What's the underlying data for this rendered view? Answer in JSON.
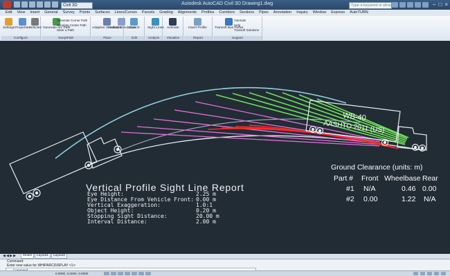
{
  "titlebar": {
    "file_tab": "Civil 3D",
    "title": "Autodesk AutoCAD Civil 3D   Drawing1.dwg",
    "search_placeholder": "Type a keyword or phrase"
  },
  "menubar": {
    "items": [
      "Edit",
      "View",
      "Insert",
      "General",
      "Survey",
      "Points",
      "Surfaces",
      "Lines/Curves",
      "Parcels",
      "Grading",
      "Alignments",
      "Profiles",
      "Corridors",
      "Sections",
      "Pipes",
      "Annotation",
      "Inquiry",
      "Window",
      "Express",
      "AutoTURN"
    ]
  },
  "ribbon": {
    "configure": {
      "label": "Configure",
      "tools": [
        "Settings",
        "Properties",
        "Vehicles"
      ]
    },
    "swept": {
      "label": "SweptPath",
      "tools": [
        "Generate Arc Path"
      ],
      "list": [
        "Generate Corner Path",
        "Simulate Center Path",
        "Steer a Path"
      ]
    },
    "place": {
      "label": "Place",
      "tools": [
        "Adaptive Simulation",
        "Vertical Simulation"
      ]
    },
    "edit": {
      "label": "Edit",
      "tools": [
        "Control"
      ]
    },
    "analyze": {
      "label": "Analyze",
      "tools": [
        "Sight Lines"
      ]
    },
    "visualize": {
      "label": "Visualize",
      "tools": [
        "Animate"
      ]
    },
    "report": {
      "label": "Report",
      "tools": [
        "Insert Profile"
      ]
    },
    "support": {
      "label": "Support",
      "tools": [
        "Transoft Bus Portal"
      ],
      "list": [
        "Tutorials",
        "Help",
        "Transoft Solutions"
      ]
    }
  },
  "drawing": {
    "truck_label_line1": "WB-40",
    "truck_label_line2": "AASHTO 2011 (US)",
    "report": {
      "title": "Vertical Profile Sight Line Report",
      "rows": [
        {
          "label": "Eye Height:",
          "value": "2.25  m"
        },
        {
          "label": "Eye Distance From Vehicle Front:",
          "value": "0.00  m"
        },
        {
          "label": "Vertical Exaggeration:",
          "value": "1.0:1"
        },
        {
          "label": "Object Height:",
          "value": "0.20  m"
        },
        {
          "label": "Stopping Sight Distance:",
          "value": "20.00  m"
        },
        {
          "label": "Interval Distance:",
          "value": "2.00  m"
        }
      ]
    },
    "ground_clearance": {
      "title": "Ground Clearance (units: m)",
      "headers": [
        "Part #",
        "Front",
        "Wheelbase",
        "Rear"
      ],
      "rows": [
        {
          "part": "#1",
          "front": "N/A",
          "wheelbase": "0.46",
          "rear": "0.00"
        },
        {
          "part": "#2",
          "front": "0.00",
          "wheelbase": "1.22",
          "rear": "N/A"
        }
      ]
    }
  },
  "layout_tabs": {
    "model": "Model",
    "layout1": "Layout1",
    "layout2": "Layout2"
  },
  "command": {
    "line1": "Command:",
    "line2": "Enter new value for WHIPARCDISPLAY <1>:",
    "prompt": "Command:"
  },
  "status": {
    "coords": "0.0000, 0.0000, 0.0000"
  },
  "colors": {
    "background": "#222c35",
    "profile_arc": "#8fd0e0",
    "sight_green": "#6ee05a",
    "sight_magenta": "#e070d8",
    "sight_red": "#ff2a2a"
  }
}
